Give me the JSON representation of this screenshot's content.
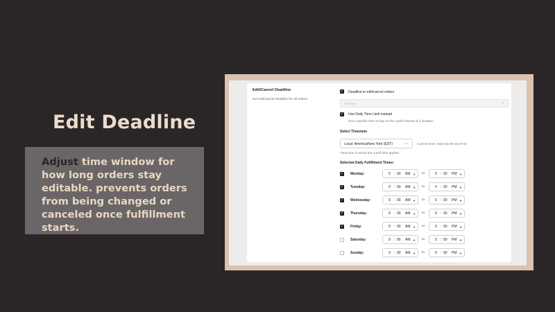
{
  "slide": {
    "headline": "Edit Deadline",
    "caption_lead": "Adjust",
    "caption_rest": " time window for how long orders stay editable. prevents orders from being changed or canceled once fulfillment starts."
  },
  "settings": {
    "section_title": "Edit/Cancel Deadline",
    "section_desc": "Set edit/cancel deadline for all orders.",
    "deadline_checkbox_label": "Deadline to edit/cancel orders",
    "duration_value": "2 hours",
    "daily_limit_label": "Use Daily Time Limit instead",
    "daily_limit_desc": "Set a specific time of day as the cutoff instead of a duration",
    "timezone_title": "Select Timezone",
    "timezone_value": "Local: America/New York (EDT)",
    "current_time": "Current time: 2026-04-08 15:47:03",
    "timezone_help": "Timezone in which the cutoff time applies",
    "fulfillment_title": "Selected Daily Fulfillment Times:",
    "to_label": "to",
    "days": [
      {
        "name": "Monday:",
        "checked": true,
        "start_h": "9",
        "start_m": "00",
        "start_ampm": "AM",
        "end_h": "5",
        "end_m": "00",
        "end_ampm": "PM"
      },
      {
        "name": "Tuesday:",
        "checked": true,
        "start_h": "9",
        "start_m": "00",
        "start_ampm": "AM",
        "end_h": "5",
        "end_m": "00",
        "end_ampm": "PM"
      },
      {
        "name": "Wednesday:",
        "checked": true,
        "start_h": "9",
        "start_m": "00",
        "start_ampm": "AM",
        "end_h": "5",
        "end_m": "00",
        "end_ampm": "PM"
      },
      {
        "name": "Thursday:",
        "checked": true,
        "start_h": "9",
        "start_m": "00",
        "start_ampm": "AM",
        "end_h": "5",
        "end_m": "00",
        "end_ampm": "PM"
      },
      {
        "name": "Friday:",
        "checked": true,
        "start_h": "9",
        "start_m": "00",
        "start_ampm": "AM",
        "end_h": "5",
        "end_m": "00",
        "end_ampm": "PM"
      },
      {
        "name": "Saturday:",
        "checked": false,
        "start_h": "9",
        "start_m": "00",
        "start_ampm": "AM",
        "end_h": "5",
        "end_m": "00",
        "end_ampm": "PM"
      },
      {
        "name": "Sunday:",
        "checked": false,
        "start_h": "9",
        "start_m": "00",
        "start_ampm": "AM",
        "end_h": "5",
        "end_m": "00",
        "end_ampm": "PM"
      }
    ]
  },
  "colors": {
    "background": "#2a2627",
    "headline": "#ecdccb",
    "caption_box": "#6a6667",
    "frame": "#d9c2ae"
  },
  "icons": {
    "check": "checkmark-icon",
    "caret": "chevron-down-icon"
  }
}
